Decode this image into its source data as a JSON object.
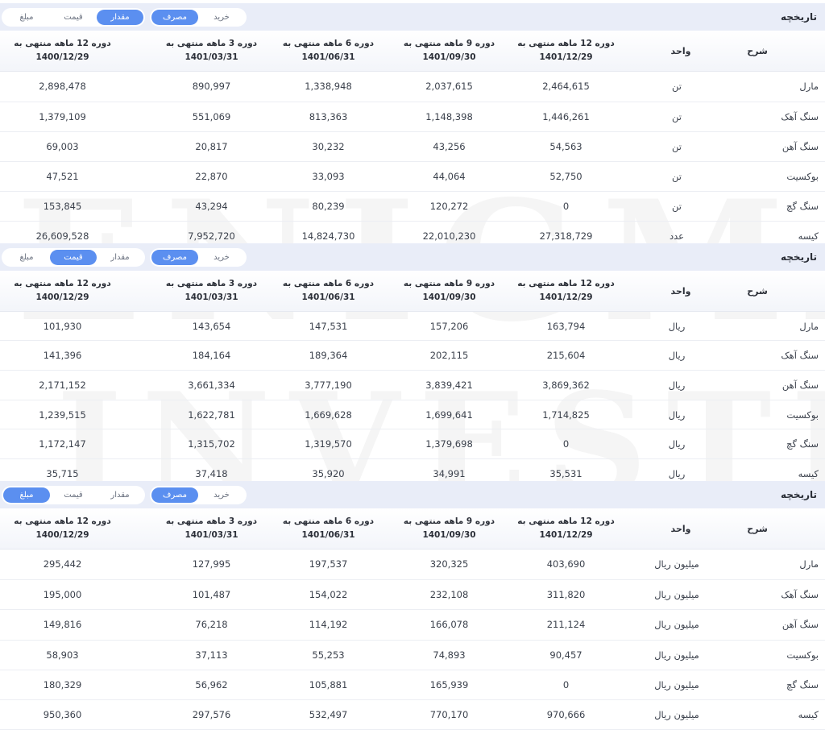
{
  "sections": [
    {
      "title": "تاریخچه",
      "toggle_type": [
        "خرید",
        "مصرف"
      ],
      "toggle_type_active": 1,
      "toggle_measure": [
        "مقدار",
        "قیمت",
        "مبلغ"
      ],
      "toggle_measure_active": 0,
      "headers": {
        "desc": "شرح",
        "unit": "واحد",
        "periods": [
          [
            "دوره 12 ماهه منتهی به",
            "1401/12/29"
          ],
          [
            "دوره 9 ماهه منتهی به",
            "1401/09/30"
          ],
          [
            "دوره 6 ماهه منتهی به",
            "1401/06/31"
          ],
          [
            "دوره 3 ماهه منتهی به",
            "1401/03/31"
          ],
          [
            "دوره 12 ماهه منتهی به",
            "1400/12/29"
          ]
        ]
      },
      "rows": [
        {
          "desc": "مارل",
          "unit": "تن",
          "values": [
            "2,464,615",
            "2,037,615",
            "1,338,948",
            "890,997",
            "2,898,478"
          ]
        },
        {
          "desc": "سنگ آهک",
          "unit": "تن",
          "values": [
            "1,446,261",
            "1,148,398",
            "813,363",
            "551,069",
            "1,379,109"
          ]
        },
        {
          "desc": "سنگ آهن",
          "unit": "تن",
          "values": [
            "54,563",
            "43,256",
            "30,232",
            "20,817",
            "69,003"
          ]
        },
        {
          "desc": "بوکسیت",
          "unit": "تن",
          "values": [
            "52,750",
            "44,064",
            "33,093",
            "22,870",
            "47,521"
          ]
        },
        {
          "desc": "سنگ گچ",
          "unit": "تن",
          "values": [
            "0",
            "120,272",
            "80,239",
            "43,294",
            "153,845"
          ]
        },
        {
          "desc": "کیسه",
          "unit": "عدد",
          "values": [
            "27,318,729",
            "22,010,230",
            "14,824,730",
            "7,952,720",
            "26,609,528"
          ]
        }
      ]
    },
    {
      "title": "تاریخچه",
      "toggle_type": [
        "خرید",
        "مصرف"
      ],
      "toggle_type_active": 1,
      "toggle_measure": [
        "مقدار",
        "قیمت",
        "مبلغ"
      ],
      "toggle_measure_active": 1,
      "headers": {
        "desc": "شرح",
        "unit": "واحد",
        "periods": [
          [
            "دوره 12 ماهه منتهی به",
            "1401/12/29"
          ],
          [
            "دوره 9 ماهه منتهی به",
            "1401/09/30"
          ],
          [
            "دوره 6 ماهه منتهی به",
            "1401/06/31"
          ],
          [
            "دوره 3 ماهه منتهی به",
            "1401/03/31"
          ],
          [
            "دوره 12 ماهه منتهی به",
            "1400/12/29"
          ]
        ]
      },
      "rows": [
        {
          "desc": "مارل",
          "unit": "ریال",
          "values": [
            "163,794",
            "157,206",
            "147,531",
            "143,654",
            "101,930"
          ]
        },
        {
          "desc": "سنگ آهک",
          "unit": "ریال",
          "values": [
            "215,604",
            "202,115",
            "189,364",
            "184,164",
            "141,396"
          ]
        },
        {
          "desc": "سنگ آهن",
          "unit": "ریال",
          "values": [
            "3,869,362",
            "3,839,421",
            "3,777,190",
            "3,661,334",
            "2,171,152"
          ]
        },
        {
          "desc": "بوکسیت",
          "unit": "ریال",
          "values": [
            "1,714,825",
            "1,699,641",
            "1,669,628",
            "1,622,781",
            "1,239,515"
          ]
        },
        {
          "desc": "سنگ گچ",
          "unit": "ریال",
          "values": [
            "0",
            "1,379,698",
            "1,319,570",
            "1,315,702",
            "1,172,147"
          ]
        },
        {
          "desc": "کیسه",
          "unit": "ریال",
          "values": [
            "35,531",
            "34,991",
            "35,920",
            "37,418",
            "35,715"
          ]
        }
      ]
    },
    {
      "title": "تاریخچه",
      "toggle_type": [
        "خرید",
        "مصرف"
      ],
      "toggle_type_active": 1,
      "toggle_measure": [
        "مقدار",
        "قیمت",
        "مبلغ"
      ],
      "toggle_measure_active": 2,
      "headers": {
        "desc": "شرح",
        "unit": "واحد",
        "periods": [
          [
            "دوره 12 ماهه منتهی به",
            "1401/12/29"
          ],
          [
            "دوره 9 ماهه منتهی به",
            "1401/09/30"
          ],
          [
            "دوره 6 ماهه منتهی به",
            "1401/06/31"
          ],
          [
            "دوره 3 ماهه منتهی به",
            "1401/03/31"
          ],
          [
            "دوره 12 ماهه منتهی به",
            "1400/12/29"
          ]
        ]
      },
      "rows": [
        {
          "desc": "مارل",
          "unit": "میلیون ریال",
          "values": [
            "403,690",
            "320,325",
            "197,537",
            "127,995",
            "295,442"
          ]
        },
        {
          "desc": "سنگ آهک",
          "unit": "میلیون ریال",
          "values": [
            "311,820",
            "232,108",
            "154,022",
            "101,487",
            "195,000"
          ]
        },
        {
          "desc": "سنگ آهن",
          "unit": "میلیون ریال",
          "values": [
            "211,124",
            "166,078",
            "114,192",
            "76,218",
            "149,816"
          ]
        },
        {
          "desc": "بوکسیت",
          "unit": "میلیون ریال",
          "values": [
            "90,457",
            "74,893",
            "55,253",
            "37,113",
            "58,903"
          ]
        },
        {
          "desc": "سنگ گچ",
          "unit": "میلیون ریال",
          "values": [
            "0",
            "165,939",
            "105,881",
            "56,962",
            "180,329"
          ]
        },
        {
          "desc": "کیسه",
          "unit": "میلیون ریال",
          "values": [
            "970,666",
            "770,170",
            "532,497",
            "297,576",
            "950,360"
          ]
        }
      ]
    }
  ],
  "watermark": [
    "ENIGMA",
    "INVESTING"
  ],
  "colors": {
    "header_bg": "#e9edf8",
    "active_pill": "#5b8ff0"
  }
}
